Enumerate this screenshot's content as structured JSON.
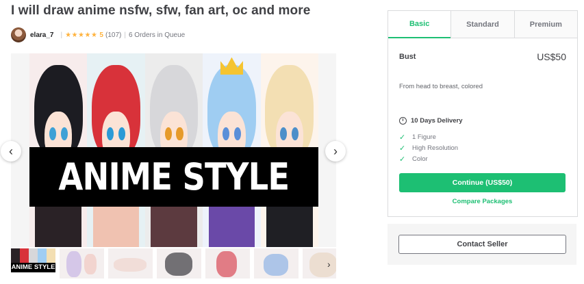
{
  "gig": {
    "title": "I will draw anime nsfw, sfw, fan art, oc and more"
  },
  "seller": {
    "username": "elara_7",
    "rating": "5",
    "review_count": "(107)",
    "orders_in_queue": "6 Orders in Queue"
  },
  "gallery": {
    "banner_text": "ANIME STYLE",
    "thumbnail_label": "ANIME STYLE",
    "thumbnail_count": 7
  },
  "package": {
    "tabs": [
      {
        "label": "Basic",
        "active": true
      },
      {
        "label": "Standard",
        "active": false
      },
      {
        "label": "Premium",
        "active": false
      }
    ],
    "name": "Bust",
    "price": "US$50",
    "description": "From head to breast, colored",
    "delivery": "10 Days Delivery",
    "features": [
      "1 Figure",
      "High Resolution",
      "Color"
    ],
    "continue_label": "Continue (US$50)",
    "compare_label": "Compare Packages"
  },
  "contact": {
    "label": "Contact Seller"
  },
  "colors": {
    "accent": "#1dbf73",
    "star": "#ffb33e",
    "text": "#404145"
  }
}
